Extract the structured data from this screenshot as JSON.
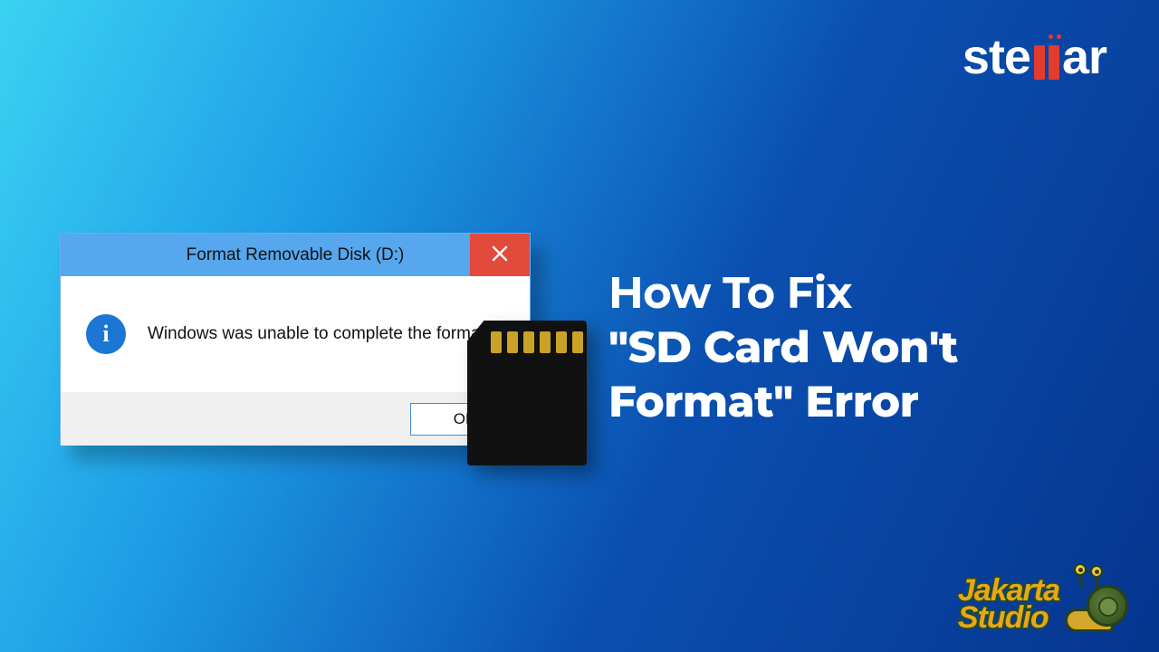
{
  "brand_top": {
    "text_left": "ste",
    "text_right": "ar"
  },
  "dialog": {
    "title": "Format Removable Disk (D:)",
    "message": "Windows was unable to complete the format.",
    "ok_label": "OK",
    "info_glyph": "i",
    "close_glyph": "×"
  },
  "headline": {
    "line1": "How To Fix",
    "line2": "\"SD Card Won't",
    "line3": "Format\" Error"
  },
  "brand_bottom": {
    "line1": "Jakarta",
    "line2": "Studio"
  }
}
